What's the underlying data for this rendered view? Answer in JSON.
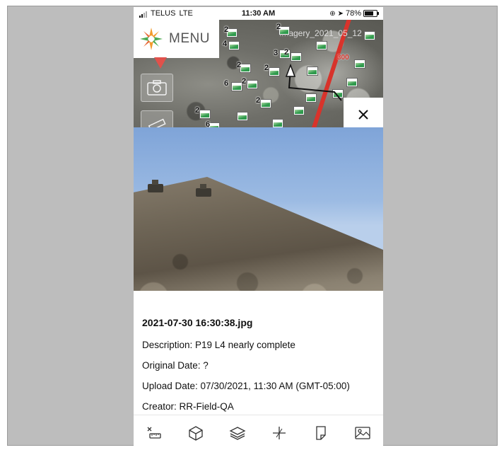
{
  "status_bar": {
    "carrier": "TELUS",
    "network": "LTE",
    "time": "11:30 AM",
    "battery": "78%",
    "battery_level": 0.78
  },
  "map": {
    "menu_label": "MENU",
    "layer_label": "Imagery_2021_05_12",
    "road_label": "300",
    "cluster_counts": [
      "2",
      "4",
      "2",
      "3",
      "2",
      "2",
      "6",
      "2",
      "2",
      "2",
      "6"
    ]
  },
  "photo_detail": {
    "filename": "2021-07-30 16:30:38.jpg",
    "description": "Description: P19 L4 nearly complete",
    "original_date": "Original Date: ?",
    "upload_date": "Upload Date: 07/30/2021, 11:30 AM (GMT-05:00)",
    "creator": "Creator: RR-Field-QA"
  },
  "toolbar": {
    "items": [
      "measure-tool-icon",
      "3d-model-icon",
      "layers-icon",
      "compass-icon",
      "document-icon",
      "image-gallery-icon"
    ]
  },
  "colors": {
    "logo_orange": "#f29b2e",
    "logo_green": "#4caa52",
    "pin_red": "#e0514b",
    "road_red": "#d8332b"
  }
}
